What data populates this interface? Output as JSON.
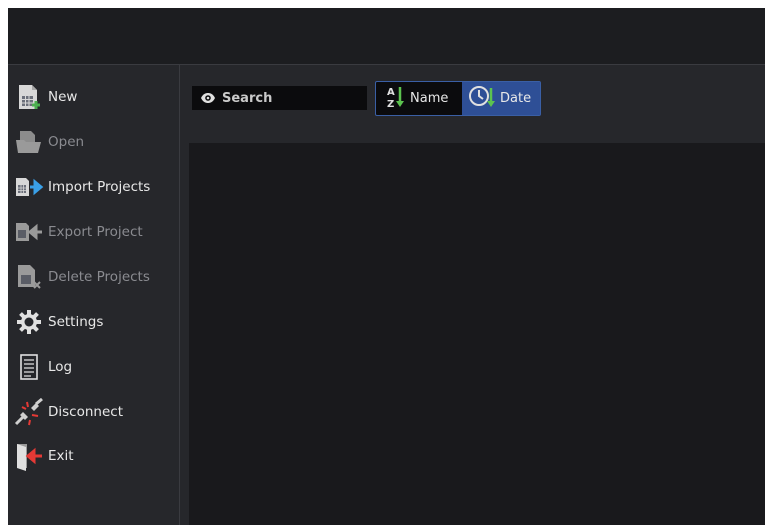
{
  "sidebar": {
    "items": [
      {
        "label": "New",
        "icon": "new-project-icon",
        "disabled": false
      },
      {
        "label": "Open",
        "icon": "open-folder-icon",
        "disabled": true
      },
      {
        "label": "Import Projects",
        "icon": "import-projects-icon",
        "disabled": false
      },
      {
        "label": "Export Project",
        "icon": "export-project-icon",
        "disabled": true
      },
      {
        "label": "Delete Projects",
        "icon": "delete-projects-icon",
        "disabled": true
      },
      {
        "label": "Settings",
        "icon": "gear-icon",
        "disabled": false
      },
      {
        "label": "Log",
        "icon": "log-document-icon",
        "disabled": false
      },
      {
        "label": "Disconnect",
        "icon": "disconnect-plug-icon",
        "disabled": false
      },
      {
        "label": "Exit",
        "icon": "exit-door-icon",
        "disabled": false
      }
    ]
  },
  "toolbar": {
    "search": {
      "placeholder": "Search",
      "icon": "eye-icon"
    },
    "sort": {
      "name_label": "Name",
      "date_label": "Date",
      "active": "Date",
      "name_icon": "sort-az-icon",
      "date_icon": "clock-sort-icon"
    }
  },
  "colors": {
    "background": "#26272b",
    "titlebar": "#1c1d20",
    "content": "#19191c",
    "accent": "#2e4f96",
    "accent_border": "#3a5fa5",
    "import_arrow": "#3aa0e8",
    "exit_arrow": "#e53935",
    "sort_arrow": "#5cc34f"
  }
}
